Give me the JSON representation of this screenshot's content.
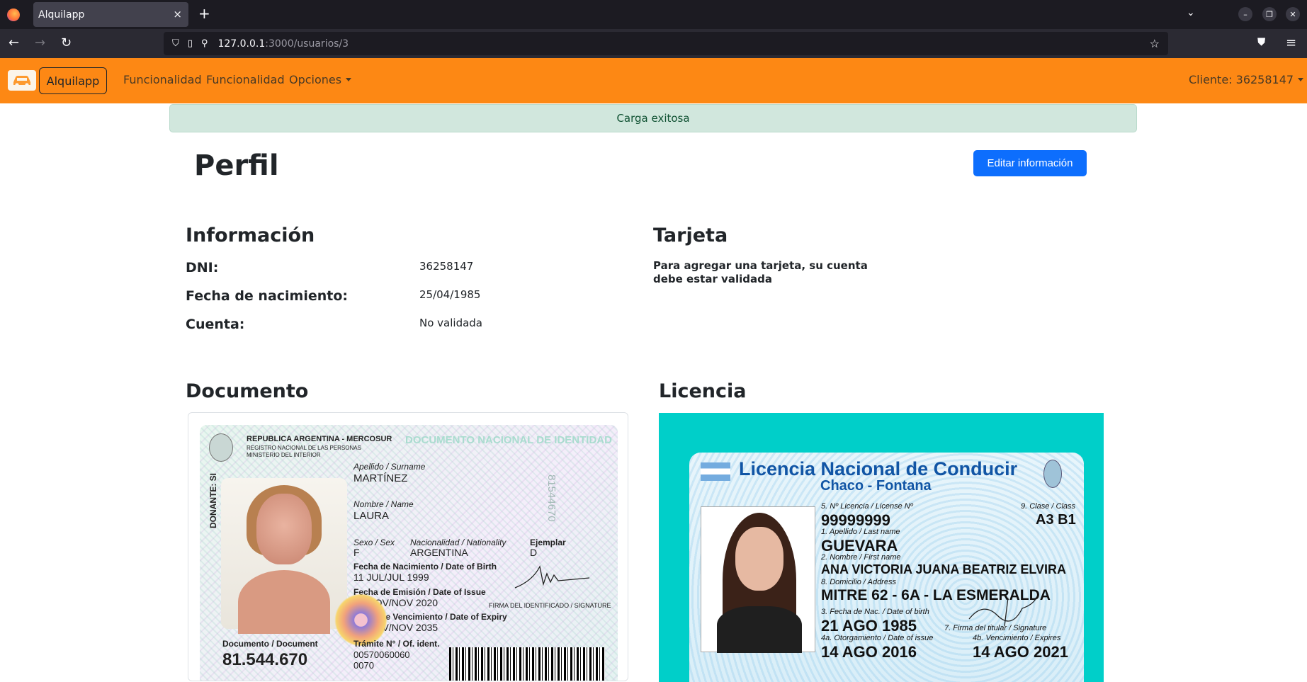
{
  "browser": {
    "tab_title": "Alquilapp",
    "tab_close": "×",
    "new_tab": "+",
    "url_host": "127.0.0.1",
    "url_rest": ":3000/usuarios/3"
  },
  "navbar": {
    "brand": "Alquilapp",
    "links": [
      "Funcionalidad",
      "Funcionalidad",
      "Opciones"
    ],
    "user": "Cliente: 36258147",
    "bg_color": "#fd8814"
  },
  "alert": {
    "text": "Carga exitosa",
    "color": "#d1e7dd"
  },
  "profile": {
    "title": "Perfil",
    "edit_button": "Editar información",
    "info": {
      "heading": "Información",
      "rows": [
        {
          "label": "DNI:",
          "value": "36258147"
        },
        {
          "label": "Fecha de nacimiento:",
          "value": "25/04/1985"
        },
        {
          "label": "Cuenta:",
          "value": "No validada"
        }
      ]
    },
    "card": {
      "heading": "Tarjeta",
      "message": "Para agregar una tarjeta, su cuenta debe estar validada"
    },
    "document": {
      "heading": "Documento",
      "header1": "REPUBLICA ARGENTINA - MERCOSUR",
      "header2": "REGISTRO NACIONAL DE LAS PERSONAS",
      "header3": "MINISTERIO DEL INTERIOR",
      "doc_title": "DOCUMENTO NACIONAL DE IDENTIDAD",
      "donante": "DONANTE: SI",
      "serial": "81544670",
      "surname_label": "Apellido / Surname",
      "surname": "MARTÍNEZ",
      "name_label": "Nombre / Name",
      "name": "LAURA",
      "sex_label": "Sexo / Sex",
      "sex": "F",
      "nationality_label": "Nacionalidad / Nationality",
      "nationality": "ARGENTINA",
      "copy_label": "Ejemplar",
      "copy": "D",
      "birth_label": "Fecha de Nacimiento / Date of Birth",
      "birth": "11 JUL/JUL 1999",
      "issue_label": "Fecha de Emisión / Date of Issue",
      "issue": "20 NOV/NOV 2020",
      "expiry_label": "Fecha de Vencimiento / Date of Expiry",
      "expiry": "20 NOV/NOV 2035",
      "signature_label": "FIRMA DEL IDENTIFICADO / SIGNATURE",
      "document_label": "Documento / Document",
      "document_number": "81.544.670",
      "tramite_label": "Trámite N° / Of. ident.",
      "tramite": "00570060060",
      "tramite2": "0070"
    },
    "license": {
      "heading": "Licencia",
      "title": "Licencia Nacional de Conducir",
      "subtitle": "Chaco - Fontana",
      "number_label": "5. Nº Licencia / License Nº",
      "number": "99999999",
      "class_label": "9. Clase / Class",
      "class": "A3 B1",
      "surname_label": "1. Apellido / Last name",
      "surname": "GUEVARA",
      "name_label": "2. Nombre / First name",
      "name": "ANA VICTORIA JUANA BEATRIZ ELVIRA",
      "address_label": "8. Domicilio / Address",
      "address": "MITRE 62 - 6A - LA ESMERALDA",
      "birth_label": "3. Fecha de Nac. / Date of birth",
      "birth": "21 AGO 1985",
      "granted_label": "4a. Otorgamiento / Date of issue",
      "granted": "14 AGO 2016",
      "signature_label": "7. Firma del titular / Signature",
      "expiry_label": "4b. Vencimiento / Expires",
      "expiry": "14 AGO 2021"
    }
  }
}
